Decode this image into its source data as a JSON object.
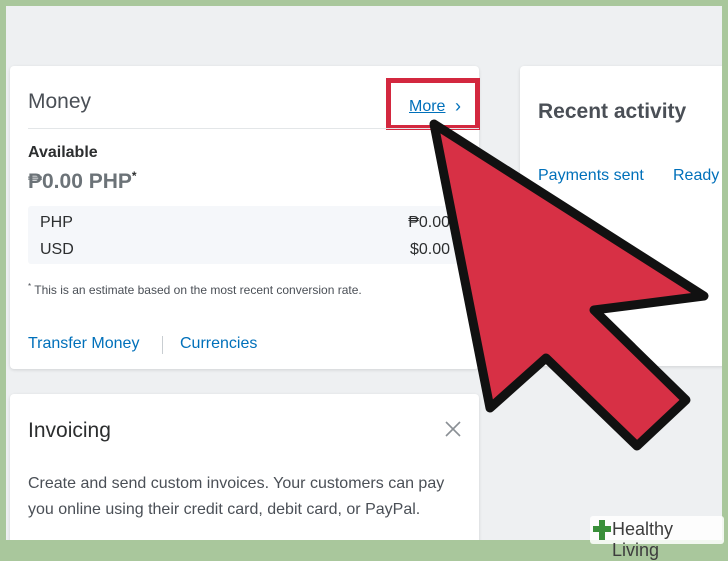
{
  "money": {
    "title": "Money",
    "more_label": "More",
    "more_chevron": "chevron-right-icon",
    "available_label": "Available",
    "available_amount": "₱0.00 PHP",
    "asterisk": "*",
    "balances": [
      {
        "currency": "PHP",
        "amount": "₱0.00"
      },
      {
        "currency": "USD",
        "amount": "$0.00"
      }
    ],
    "note": "This is an estimate based on the most recent conversion rate.",
    "transfer_label": "Transfer Money",
    "currencies_label": "Currencies"
  },
  "activity": {
    "title": "Recent activity",
    "filters": [
      "Payments sent",
      "Ready"
    ]
  },
  "invoicing": {
    "title": "Invoicing",
    "text": "Create and send custom invoices. Your customers can pay you online using their credit card, debit card, or PayPal."
  },
  "watermark": {
    "text": "Healthy Living",
    "brand_color": "#3a8f3a"
  },
  "colors": {
    "link": "#0070ba",
    "highlight": "#d3283f",
    "arrow_fill": "#d73045"
  }
}
